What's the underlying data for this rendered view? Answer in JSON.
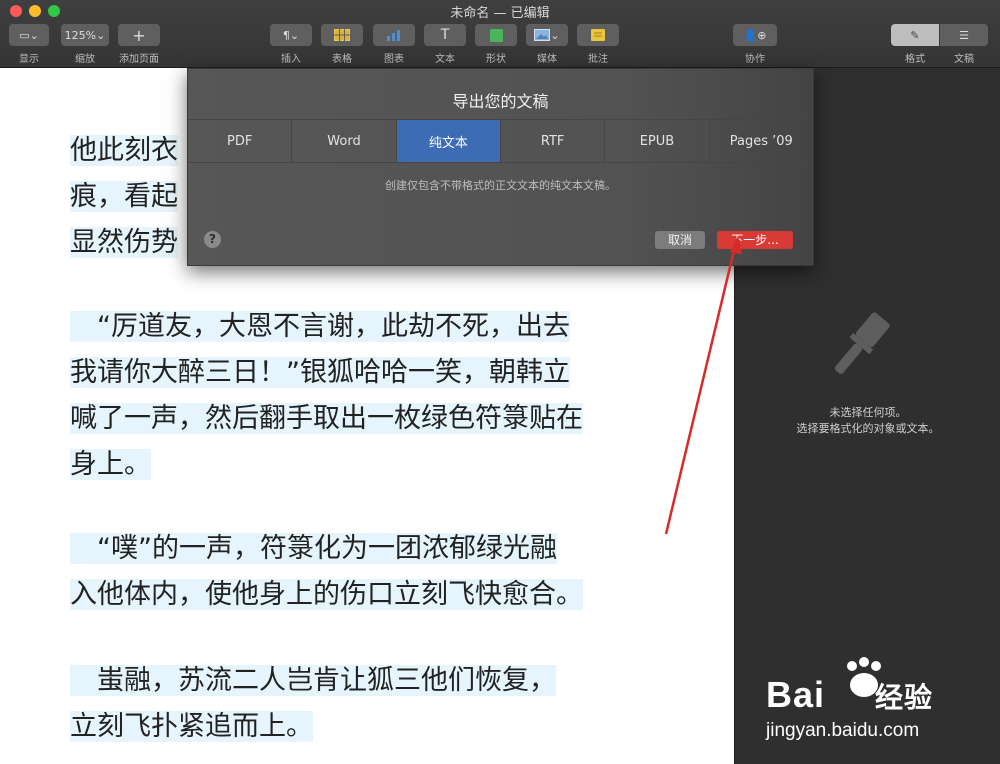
{
  "window": {
    "title": "未命名 — 已编辑"
  },
  "toolbar": {
    "view_label": "显示",
    "zoom_value": "125%",
    "zoom_label": "缩放",
    "add_page_label": "添加页面",
    "insert_label": "插入",
    "table_label": "表格",
    "chart_label": "图表",
    "text_label": "文本",
    "shape_label": "形状",
    "media_label": "媒体",
    "comment_label": "批注",
    "collaborate_label": "协作",
    "format_label": "格式",
    "document_label": "文稿"
  },
  "document": {
    "paragraphs": [
      {
        "lines": [
          "他此刻衣",
          "痕，看起",
          "显然伤势"
        ]
      },
      {
        "lines": [
          "　“厉道友，大恩不言谢，此劫不死，出去",
          "我请你大醉三日！”银狐哈哈一笑，朝韩立",
          "喊了一声，然后翻手取出一枚绿色符箓贴在",
          "身上。"
        ]
      },
      {
        "lines": [
          "　“噗”的一声，符箓化为一团浓郁绿光融",
          "入他体内，使他身上的伤口立刻飞快愈合。"
        ]
      },
      {
        "lines": [
          "　蚩融，苏流二人岂肯让狐三他们恢复，",
          "立刻飞扑紧追而上。"
        ]
      }
    ]
  },
  "dialog": {
    "title": "导出您的文稿",
    "tabs": [
      "PDF",
      "Word",
      "纯文本",
      "RTF",
      "EPUB",
      "Pages ’09"
    ],
    "selected_tab": "纯文本",
    "description": "创建仅包含不带格式的正文文本的纯文本文稿。",
    "help": "?",
    "cancel_label": "取消",
    "next_label": "下一步..."
  },
  "sidebar": {
    "line1": "未选择任何项。",
    "line2": "选择要格式化的对象或文本。"
  },
  "watermark": {
    "brand": "Bai",
    "brand2": "经验",
    "url": "jingyan.baidu.com"
  },
  "colors": {
    "accent": "#3d6bb4",
    "next_button": "#d83b35",
    "annotation_arrow": "#d92a2a",
    "highlight": "#e6f5fd"
  }
}
